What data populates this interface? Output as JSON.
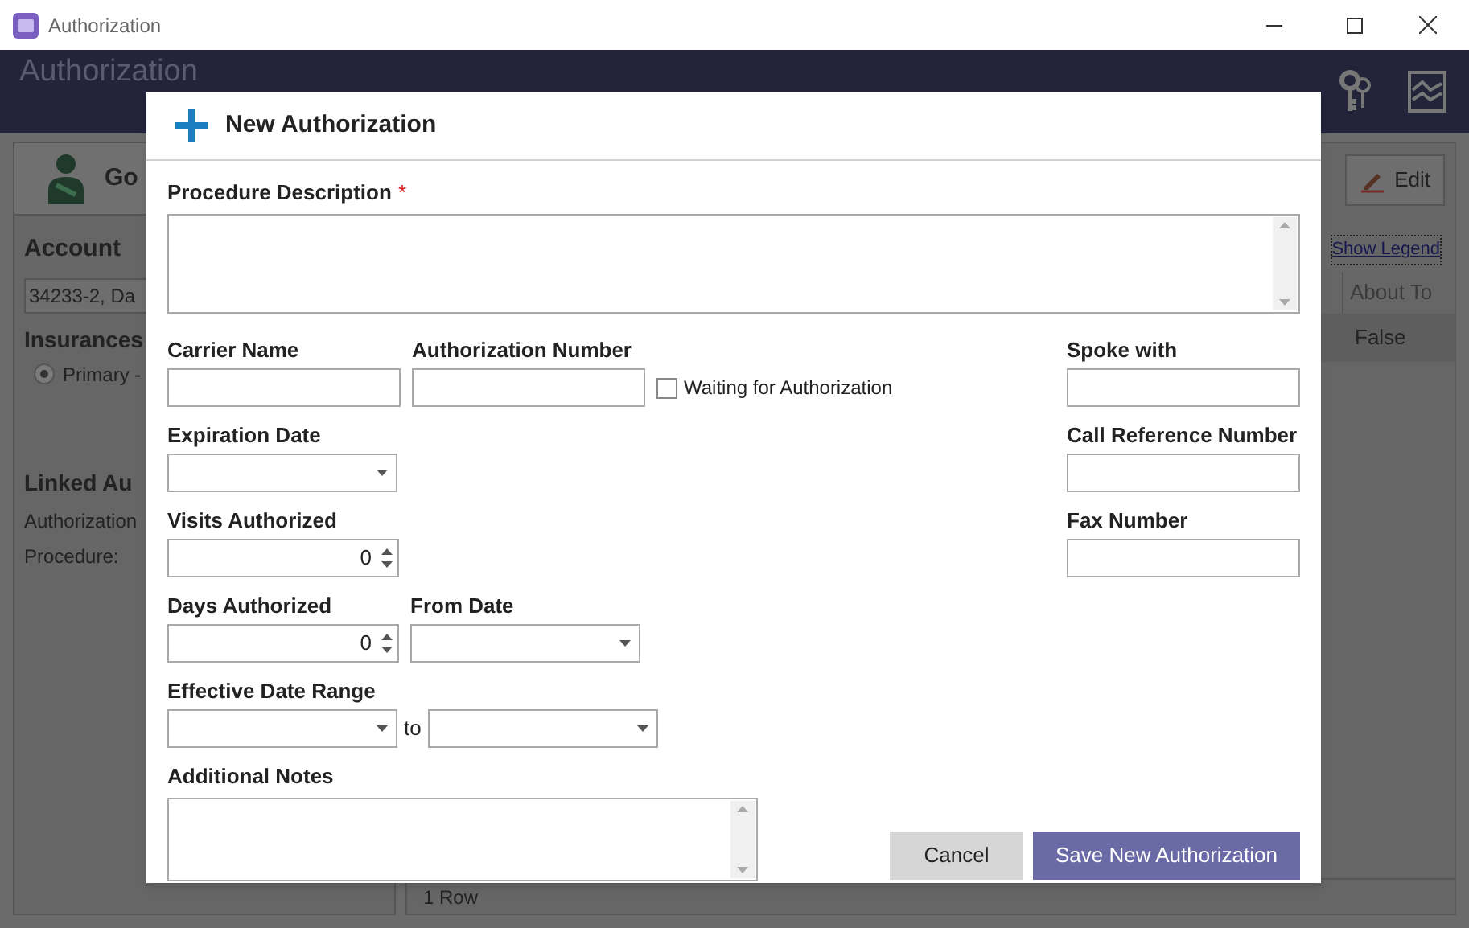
{
  "window": {
    "title": "Authorization"
  },
  "header": {
    "title": "Authorization"
  },
  "patient": {
    "name": "Go"
  },
  "edit_button": "Edit",
  "account": {
    "heading": "Account",
    "value": "34233-2, Da"
  },
  "insurances": {
    "heading": "Insurances",
    "options": [
      {
        "label": "Primary -",
        "selected": true
      }
    ]
  },
  "linked": {
    "heading": "Linked Au",
    "lines": [
      "Authorization",
      "Procedure:"
    ]
  },
  "legend_link": "Show Legend",
  "grid": {
    "column": "About To",
    "cell": "False",
    "footer": "1 Row"
  },
  "dialog": {
    "title": "New Authorization",
    "description": {
      "label": "Procedure Description",
      "required_mark": "*"
    },
    "rows": [
      {
        "fields": [
          {
            "kind": "text",
            "label": "Carrier Name"
          },
          {
            "kind": "text",
            "label": "Authorization Number"
          },
          {
            "kind": "checkbox",
            "label": "Waiting for Authorization",
            "checked": false
          }
        ],
        "side": {
          "kind": "text",
          "label": "Spoke with"
        }
      },
      {
        "fields": [
          {
            "kind": "date",
            "label": "Expiration Date"
          }
        ],
        "side": {
          "kind": "text",
          "label": "Call Reference Number"
        }
      },
      {
        "fields": [
          {
            "kind": "spinner",
            "label": "Visits Authorized",
            "value": "0"
          }
        ],
        "side": {
          "kind": "text",
          "label": "Fax Number"
        }
      },
      {
        "fields": [
          {
            "kind": "spinner",
            "label": "Days Authorized",
            "value": "0"
          },
          {
            "kind": "date",
            "label": "From Date"
          }
        ]
      },
      {
        "fields": [
          {
            "kind": "range",
            "label": "Effective Date Range",
            "joiner": "to"
          }
        ]
      }
    ],
    "notes": {
      "label": "Additional Notes"
    },
    "buttons": [
      {
        "kind": "secondary",
        "label": "Cancel"
      },
      {
        "kind": "primary",
        "label": "Save New Authorization"
      }
    ]
  }
}
